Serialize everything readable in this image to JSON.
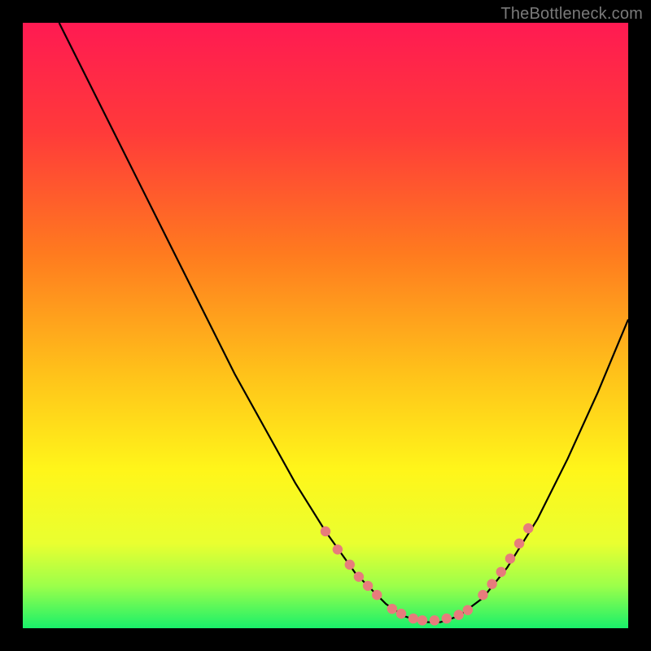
{
  "watermark": "TheBottleneck.com",
  "chart_data": {
    "type": "line",
    "title": "",
    "xlabel": "",
    "ylabel": "",
    "xlim": [
      0,
      100
    ],
    "ylim": [
      0,
      100
    ],
    "series": [
      {
        "name": "curve",
        "x": [
          6,
          10,
          15,
          20,
          25,
          30,
          35,
          40,
          45,
          50,
          55,
          60,
          63,
          66,
          69,
          72,
          76,
          80,
          85,
          90,
          95,
          100
        ],
        "y": [
          100,
          92,
          82,
          72,
          62,
          52,
          42,
          33,
          24,
          16,
          9,
          4,
          2,
          1,
          1,
          2,
          5,
          10,
          18,
          28,
          39,
          51
        ]
      }
    ],
    "markers": {
      "left_cluster": [
        {
          "x": 50,
          "y": 16
        },
        {
          "x": 52,
          "y": 13
        },
        {
          "x": 54,
          "y": 10.5
        },
        {
          "x": 55.5,
          "y": 8.5
        },
        {
          "x": 57,
          "y": 7
        },
        {
          "x": 58.5,
          "y": 5.5
        }
      ],
      "bottom_cluster": [
        {
          "x": 61,
          "y": 3.2
        },
        {
          "x": 62.5,
          "y": 2.4
        },
        {
          "x": 64.5,
          "y": 1.6
        },
        {
          "x": 66,
          "y": 1.3
        },
        {
          "x": 68,
          "y": 1.3
        },
        {
          "x": 70,
          "y": 1.6
        },
        {
          "x": 72,
          "y": 2.2
        },
        {
          "x": 73.5,
          "y": 3.0
        }
      ],
      "right_cluster": [
        {
          "x": 76,
          "y": 5.5
        },
        {
          "x": 77.5,
          "y": 7.3
        },
        {
          "x": 79,
          "y": 9.3
        },
        {
          "x": 80.5,
          "y": 11.5
        },
        {
          "x": 82,
          "y": 14
        },
        {
          "x": 83.5,
          "y": 16.5
        }
      ]
    },
    "gradient_stops": [
      {
        "offset": 0.0,
        "color": "#ff1a52"
      },
      {
        "offset": 0.18,
        "color": "#ff3a3a"
      },
      {
        "offset": 0.38,
        "color": "#ff7a1f"
      },
      {
        "offset": 0.58,
        "color": "#ffc21a"
      },
      {
        "offset": 0.74,
        "color": "#fff61a"
      },
      {
        "offset": 0.86,
        "color": "#e9ff30"
      },
      {
        "offset": 0.93,
        "color": "#9cff4a"
      },
      {
        "offset": 1.0,
        "color": "#19f06a"
      }
    ],
    "marker_color": "#e77c7c",
    "curve_color": "#000000"
  }
}
